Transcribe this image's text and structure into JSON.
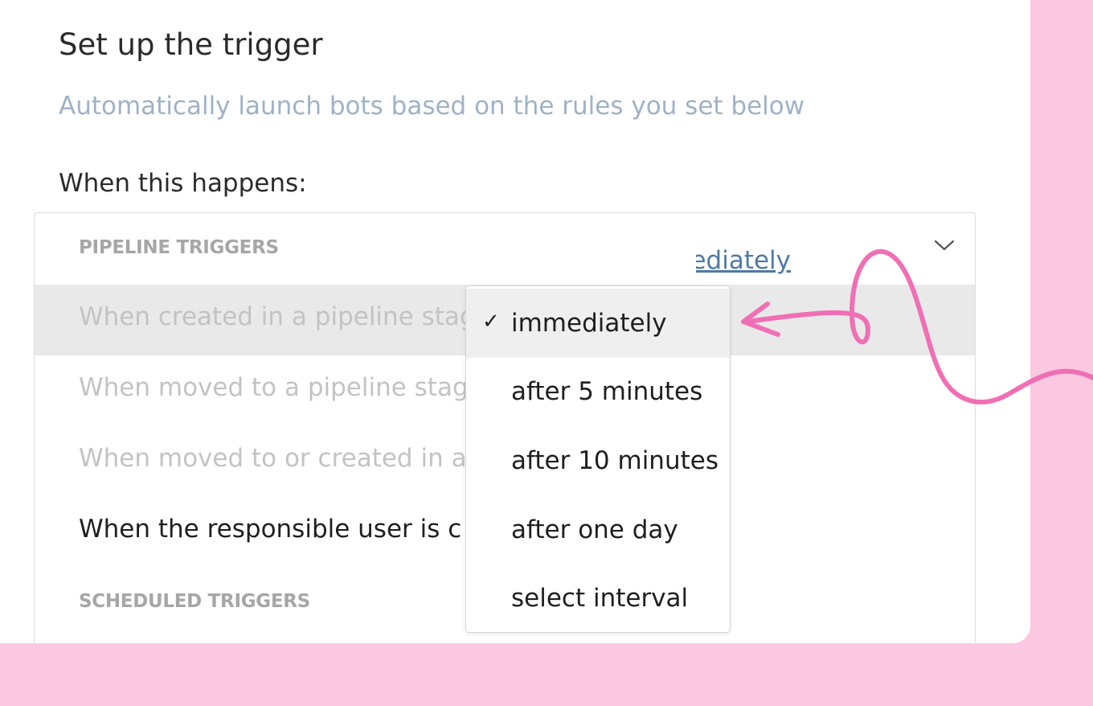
{
  "header": {
    "title": "Set up the trigger",
    "subtitle": "Automatically launch bots based on the rules you set below"
  },
  "trigger": {
    "when_label": "When this happens:",
    "groups": [
      {
        "header": "PIPELINE TRIGGERS",
        "options": [
          {
            "label": "When created in a pipeline stag",
            "highlighted": true,
            "disabled": true
          },
          {
            "label": "When moved to a pipeline stag",
            "disabled": true
          },
          {
            "label": "When moved to or created in a",
            "disabled": true,
            "link_fragment": "ediately"
          },
          {
            "label": "When the responsible user is c",
            "disabled": false
          }
        ]
      },
      {
        "header": "SCHEDULED TRIGGERS",
        "options": []
      }
    ],
    "chevron_icon": "chevron-down-icon"
  },
  "timing_dropdown": {
    "selected": "immediately",
    "check_icon": "✓",
    "items": [
      {
        "label": "immediately",
        "selected": true
      },
      {
        "label": "after 5 minutes"
      },
      {
        "label": "after 10 minutes"
      },
      {
        "label": "after one day"
      },
      {
        "label": "select interval"
      }
    ]
  },
  "colors": {
    "background": "#fcc7e0",
    "annotation_arrow": "#f06fb4",
    "link": "#4f7aa6",
    "subtitle": "#9fb2c6"
  }
}
